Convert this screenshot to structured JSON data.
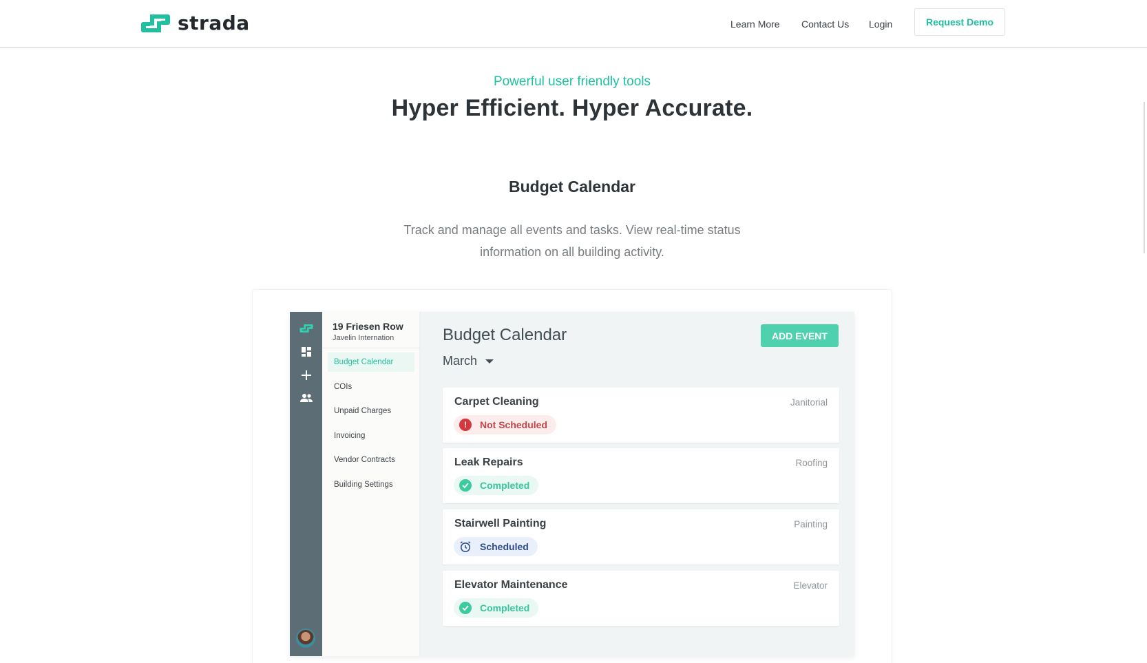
{
  "header": {
    "logo_text": "strada",
    "nav": {
      "learn_more": "Learn More",
      "contact_us": "Contact Us",
      "login": "Login"
    },
    "request_demo": "Request Demo"
  },
  "hero": {
    "kicker": "Powerful user friendly tools",
    "headline": "Hyper Efficient. Hyper Accurate."
  },
  "feature": {
    "title": "Budget Calendar",
    "description": "Track and manage all events and tasks. View real-time status information on all building activity."
  },
  "app": {
    "building": {
      "name": "19 Friesen Row",
      "org": "Javelin Internation"
    },
    "rail_icons": [
      "strada-logo-icon",
      "dashboard-icon",
      "add-icon",
      "people-icon"
    ],
    "menu": [
      "Budget Calendar",
      "COIs",
      "Unpaid Charges",
      "Invoicing",
      "Vendor Contracts",
      "Building Settings"
    ],
    "active_menu": "Budget Calendar",
    "title": "Budget Calendar",
    "add_event": "ADD EVENT",
    "month": "March",
    "events": [
      {
        "title": "Carpet Cleaning",
        "category": "Janitorial",
        "status": "Not Scheduled",
        "status_icon": "alert-icon"
      },
      {
        "title": "Leak Repairs",
        "category": "Roofing",
        "status": "Completed",
        "status_icon": "check-icon"
      },
      {
        "title": "Stairwell Painting",
        "category": "Painting",
        "status": "Scheduled",
        "status_icon": "alarm-clock-icon"
      },
      {
        "title": "Elevator Maintenance",
        "category": "Elevator",
        "status": "Completed",
        "status_icon": "check-icon"
      }
    ]
  },
  "colors": {
    "brand_teal": "#1fbf9f",
    "rail": "#5c6d75",
    "not_scheduled": "#d6373d",
    "completed": "#3ccb9f",
    "scheduled": "#2d4b8c"
  }
}
